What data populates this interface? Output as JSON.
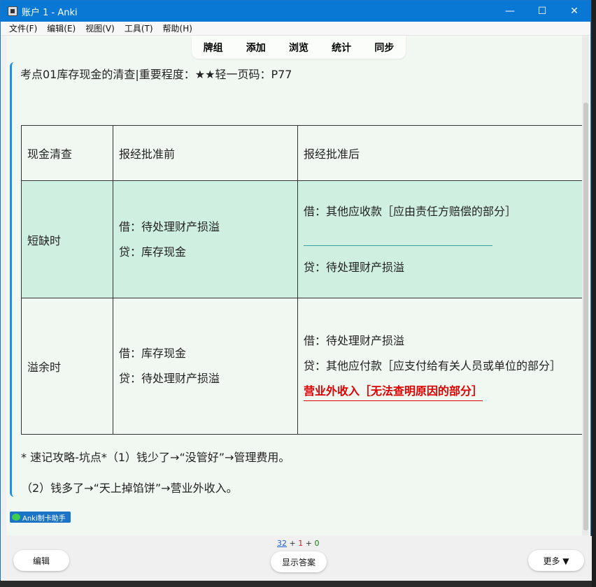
{
  "window": {
    "title": "账户 1 - Anki",
    "min": "—",
    "max": "☐",
    "close": "✕"
  },
  "menu": [
    "文件(F)",
    "编辑(E)",
    "视图(V)",
    "工具(T)",
    "帮助(H)"
  ],
  "tabs": [
    "牌组",
    "添加",
    "浏览",
    "统计",
    "同步"
  ],
  "card": {
    "header": "考点01库存现金的清查|重要程度：★★轻一页码：P77",
    "table": {
      "head": [
        "现金清查",
        "报经批准前",
        "报经批准后"
      ],
      "shortage": {
        "label": "短缺时",
        "before": [
          "借：待处理财产损溢",
          "贷：库存现金"
        ],
        "after_1": "借：其他应收款［应由责任方赔偿的部分］",
        "after_2": "贷：待处理财产损溢"
      },
      "surplus": {
        "label": "溢余时",
        "before": [
          "借：库存现金",
          "贷：待处理财产损溢"
        ],
        "after_1": "借：待处理财产损溢",
        "after_2": "贷：其他应付款［应支付给有关人员或单位的部分］",
        "after_red": "营业外收入［无法查明原因的部分］"
      }
    },
    "tip1": "* 速记攻略-坑点*（1）钱少了→“没管好”→管理费用。",
    "tip2": "（2）钱多了→“天上掉馅饼”→营业外收入。",
    "badge": "Anki制卡助手"
  },
  "counts": {
    "new": "32",
    "plus1": "+",
    "learn": "1",
    "plus2": "+",
    "due": "0"
  },
  "buttons": {
    "edit": "编辑",
    "show_answer": "显示答案",
    "more": "更多 ▼"
  },
  "colors": {
    "accent": "#1e90e6",
    "highlight_row": "#cfefe0",
    "red_text": "#e00000"
  }
}
